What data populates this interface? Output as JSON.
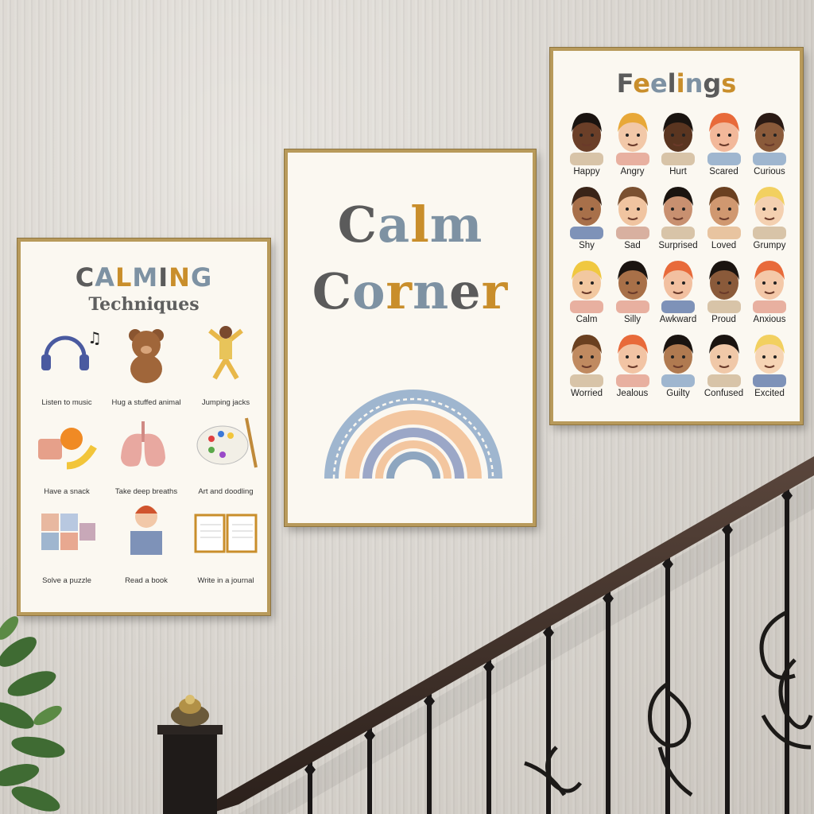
{
  "posters": {
    "left": {
      "title_line1": "CALMING",
      "title_line2": "Techniques",
      "items": [
        {
          "label": "Listen to music",
          "icon": "headphones-music-icon"
        },
        {
          "label": "Hug a stuffed animal",
          "icon": "teddy-bear-icon"
        },
        {
          "label": "Jumping jacks",
          "icon": "jumping-kid-icon"
        },
        {
          "label": "Have a snack",
          "icon": "snack-fruit-icon"
        },
        {
          "label": "Take deep breaths",
          "icon": "lungs-icon"
        },
        {
          "label": "Art and doodling",
          "icon": "paint-palette-icon"
        },
        {
          "label": "Solve a puzzle",
          "icon": "puzzle-icon"
        },
        {
          "label": "Read a book",
          "icon": "reading-kid-icon"
        },
        {
          "label": "Write in a journal",
          "icon": "journal-icon"
        }
      ]
    },
    "center": {
      "word1": "Calm",
      "word2": "Corner"
    },
    "right": {
      "title": "Feelings",
      "feelings": [
        "Happy",
        "Angry",
        "Hurt",
        "Scared",
        "Curious",
        "Shy",
        "Sad",
        "Surprised",
        "Loved",
        "Grumpy",
        "Calm",
        "Silly",
        "Awkward",
        "Proud",
        "Anxious",
        "Worried",
        "Jealous",
        "Guilty",
        "Confused",
        "Excited"
      ]
    }
  },
  "colors": {
    "dark_gray": "#5b5b5b",
    "blue_gray": "#7e92a3",
    "mustard": "#c98e2b",
    "peach": "#f3c69f",
    "light_blue": "#9fb6cf",
    "frame_gold": "#b89a5b"
  }
}
